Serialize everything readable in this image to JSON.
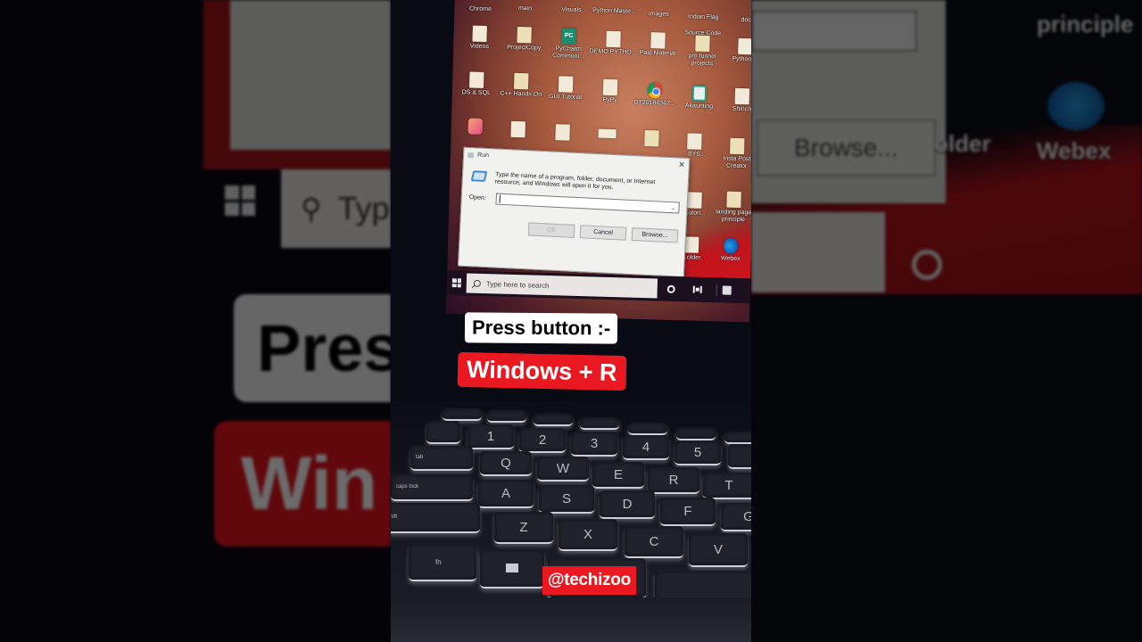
{
  "desktop": {
    "top_row_labels": [
      "Chrome",
      "main",
      "Visuals",
      "Python Maste...",
      "images",
      "Indian Flag Source Code",
      "doc"
    ],
    "icons": [
      {
        "label": "Videos",
        "type": "file"
      },
      {
        "label": "ProjectCopy",
        "type": "folder"
      },
      {
        "label": "PyCharm Communi...",
        "type": "pycharm"
      },
      {
        "label": "DEMO PYTHO...",
        "type": "file"
      },
      {
        "label": "Paid Material",
        "type": "file"
      },
      {
        "label": "pro funnel projects",
        "type": "folder"
      },
      {
        "label": "Python lo",
        "type": "file"
      },
      {
        "label": "DS & SQL",
        "type": "file"
      },
      {
        "label": "C++ Hands On",
        "type": "folder"
      },
      {
        "label": "GUI Tutorial",
        "type": "file"
      },
      {
        "label": "PyPy",
        "type": "file"
      },
      {
        "label": "DT20184347...",
        "type": "chrome"
      },
      {
        "label": "Akaunting",
        "type": "akaunting"
      },
      {
        "label": "Shinch",
        "type": "file"
      },
      {
        "label": "",
        "type": "pink-app"
      },
      {
        "label": "",
        "type": "file"
      },
      {
        "label": "",
        "type": "file"
      },
      {
        "label": "",
        "type": "blank"
      },
      {
        "label": "",
        "type": "folder"
      },
      {
        "label": "...BYS...",
        "type": "file"
      },
      {
        "label": "Insta Post Creator",
        "type": "folder"
      },
      {
        "label": "...utori...",
        "type": "file"
      },
      {
        "label": "landing page principle",
        "type": "folder"
      },
      {
        "label": "...older",
        "type": "file"
      },
      {
        "label": "Webex",
        "type": "webex"
      }
    ]
  },
  "run_dialog": {
    "title": "Run",
    "description": "Type the name of a program, folder, document, or Internet resource, and Windows will open it for you.",
    "open_label": "Open:",
    "open_value": "",
    "buttons": {
      "ok": "OK",
      "cancel": "Cancel",
      "browse": "Browse..."
    }
  },
  "taskbar": {
    "search_placeholder": "Type here to search"
  },
  "overlay": {
    "instruction": "Press button :-",
    "shortcut": "Windows + R",
    "handle": "@techizoo"
  },
  "keyboard": {
    "row_numbers": [
      "1",
      "2",
      "3",
      "4",
      "5"
    ],
    "row_top": [
      "Q",
      "W",
      "E",
      "R",
      "T"
    ],
    "row_home": [
      "A",
      "S",
      "D",
      "F",
      "G"
    ],
    "row_bottom": [
      "Z",
      "X",
      "C",
      "V"
    ],
    "mod_tab": "tab",
    "mod_caps": "caps lock",
    "mod_shift": "shift",
    "mod_fn": "fn"
  },
  "backdrop": {
    "left_search_fragment": "Typ",
    "left_press_fragment": "Pres",
    "left_win_fragment": "Win",
    "right_browse": "Browse...",
    "right_label_top": "principle",
    "right_label_folder": "older",
    "right_label_webex": "Webex"
  },
  "colors": {
    "caption_red": "#ea1820",
    "caption_white": "#ffffff",
    "taskbar": "#1c0f1f"
  }
}
